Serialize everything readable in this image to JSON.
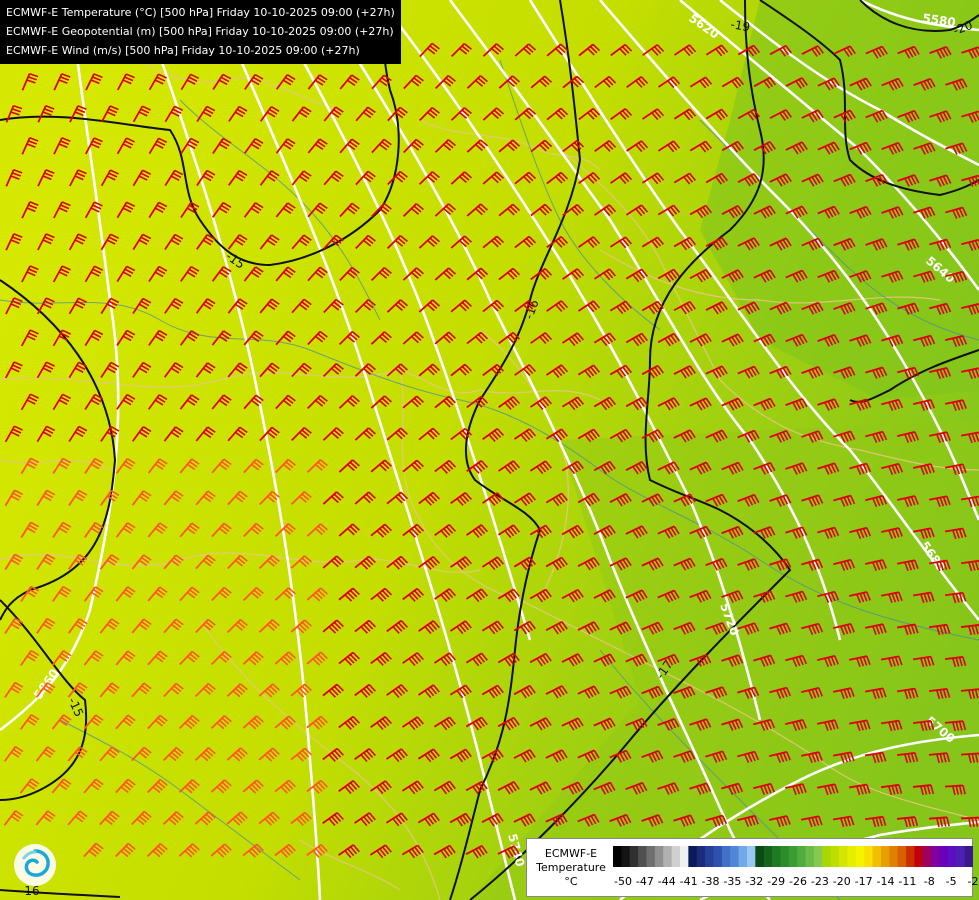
{
  "header": {
    "lines": [
      "ECMWF-E Temperature (°C) [500 hPa] Friday 10-10-2025 09:00 (+27h)",
      "ECMWF-E Geopotential (m) [500 hPa] Friday 10-10-2025 09:00 (+27h)",
      "ECMWF-E Wind (m/s) [500 hPa] Friday 10-10-2025 09:00 (+27h)"
    ]
  },
  "map": {
    "geopotential_labels": [
      "5580",
      "5620",
      "5640",
      "5680",
      "5700",
      "5720",
      "5740",
      "5860"
    ],
    "temperature_labels": [
      "-15",
      "-16",
      "-17",
      "-19",
      "-20",
      "-15",
      "-16"
    ],
    "colors": {
      "bg_west": "#d2e600",
      "bg_mid": "#c8e000",
      "bg_east": "#8cc818",
      "bg_northeast": "#78c020",
      "isohypse": "#ffffff",
      "isotherm": "#000000",
      "wind_barb": "#dd0011",
      "wind_barb_weak": "#ff5522",
      "borders": "#e8c880",
      "rivers": "#4a8a9a"
    }
  },
  "legend": {
    "title_lines": [
      "ECMWF-E",
      "Temperature",
      "°C"
    ],
    "ticks": [
      "-50",
      "-47",
      "-44",
      "-41",
      "-38",
      "-35",
      "-32",
      "-29",
      "-26",
      "-23",
      "-20",
      "-17",
      "-14",
      "-11",
      "-8",
      "-5",
      "-2"
    ],
    "colors": [
      "#000000",
      "#141414",
      "#303030",
      "#505050",
      "#707070",
      "#909090",
      "#b0b0b0",
      "#d0d0d0",
      "#f0f0f0",
      "#0a1a5a",
      "#1c2c7a",
      "#26409a",
      "#3050b0",
      "#4070c8",
      "#5088d8",
      "#70a8e8",
      "#98c8f0",
      "#0a4a14",
      "#14641c",
      "#1e7a22",
      "#2c8c2a",
      "#3c9c34",
      "#50ac3e",
      "#6abc48",
      "#86c852",
      "#a8d800",
      "#bede00",
      "#d2e600",
      "#e6ee00",
      "#f4f400",
      "#f8e000",
      "#f0c000",
      "#e8a000",
      "#e08000",
      "#d86000",
      "#cc3000",
      "#c00010",
      "#a00060",
      "#8000a0",
      "#6a00b8",
      "#5a10c0",
      "#4c20b0",
      "#3a1890"
    ]
  },
  "logo": {
    "icon": "ecmwf-swirl-icon"
  }
}
